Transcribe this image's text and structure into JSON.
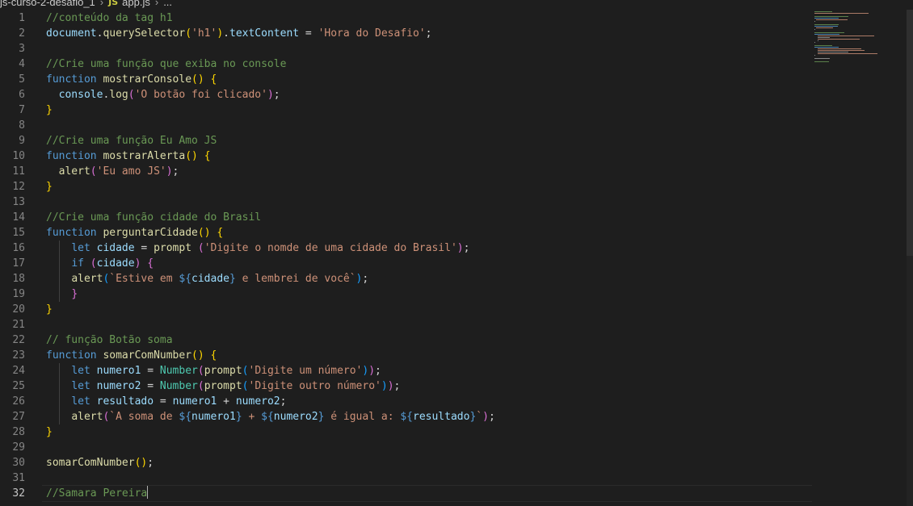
{
  "breadcrumb": {
    "folder": "js-curso-2-desafio_1",
    "file_badge": "JS",
    "file": "app.js",
    "symbol": "..."
  },
  "editor": {
    "language": "javascript",
    "cursor_line": 32,
    "lines": [
      {
        "n": "1",
        "text": "//conteúdo da tag h1"
      },
      {
        "n": "2",
        "text": "document.querySelector('h1').textContent = 'Hora do Desafio';"
      },
      {
        "n": "3",
        "text": ""
      },
      {
        "n": "4",
        "text": "//Crie uma função que exiba no console"
      },
      {
        "n": "5",
        "text": "function mostrarConsole() {"
      },
      {
        "n": "6",
        "text": "  console.log('O botão foi clicado');"
      },
      {
        "n": "7",
        "text": "}"
      },
      {
        "n": "8",
        "text": ""
      },
      {
        "n": "9",
        "text": "//Crie uma função Eu Amo JS"
      },
      {
        "n": "10",
        "text": "function mostrarAlerta() {"
      },
      {
        "n": "11",
        "text": "  alert('Eu amo JS');"
      },
      {
        "n": "12",
        "text": "}"
      },
      {
        "n": "13",
        "text": ""
      },
      {
        "n": "14",
        "text": "//Crie uma função cidade do Brasil"
      },
      {
        "n": "15",
        "text": "function perguntarCidade() {"
      },
      {
        "n": "16",
        "text": "    let cidade = prompt ('Digite o nomde de uma cidade do Brasil');"
      },
      {
        "n": "17",
        "text": "    if (cidade) {"
      },
      {
        "n": "18",
        "text": "    alert(`Estive em ${cidade} e lembrei de você`);"
      },
      {
        "n": "19",
        "text": "    }"
      },
      {
        "n": "20",
        "text": "}"
      },
      {
        "n": "21",
        "text": ""
      },
      {
        "n": "22",
        "text": "// função Botão soma"
      },
      {
        "n": "23",
        "text": "function somarComNumber() {"
      },
      {
        "n": "24",
        "text": "    let numero1 = Number(prompt('Digite um número'));"
      },
      {
        "n": "25",
        "text": "    let numero2 = Number(prompt('Digite outro número'));"
      },
      {
        "n": "26",
        "text": "    let resultado = numero1 + numero2;"
      },
      {
        "n": "27",
        "text": "    alert(`A soma de ${numero1} + ${numero2} é igual a: ${resultado}`);"
      },
      {
        "n": "28",
        "text": "}"
      },
      {
        "n": "29",
        "text": ""
      },
      {
        "n": "30",
        "text": "somarComNumber();"
      },
      {
        "n": "31",
        "text": ""
      },
      {
        "n": "32",
        "text": "//Samara Pereira"
      }
    ]
  },
  "theme": {
    "background": "#1e1e1e",
    "comment": "#6a9955",
    "keyword": "#569cd6",
    "function": "#dcdcaa",
    "string": "#ce9178",
    "variable": "#9cdcfe",
    "type": "#4ec9b0",
    "bracket_1": "#ffd700",
    "bracket_2": "#da70d6",
    "bracket_3": "#179fff"
  }
}
